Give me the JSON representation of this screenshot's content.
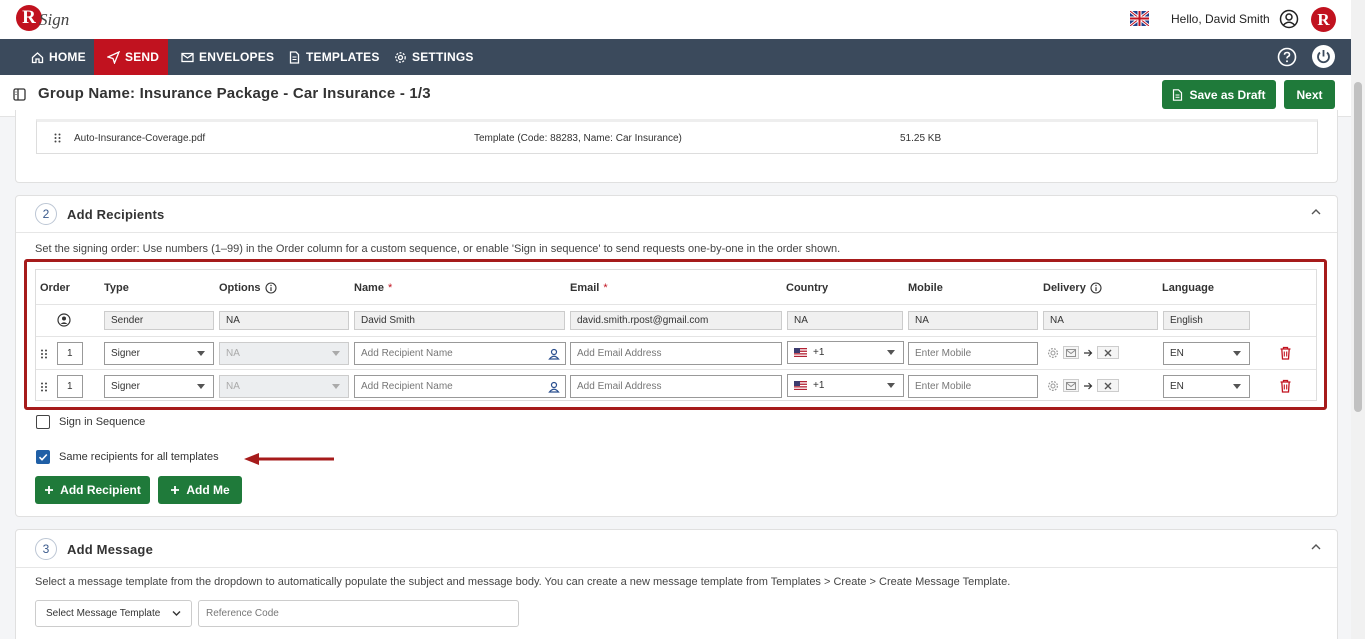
{
  "header": {
    "logo_letter": "R",
    "logo_text": "Sign",
    "greeting": "Hello, David Smith",
    "brand_letter": "R"
  },
  "nav": {
    "items": [
      {
        "label": "HOME",
        "icon": "home-icon"
      },
      {
        "label": "SEND",
        "icon": "send-icon",
        "active": true
      },
      {
        "label": "ENVELOPES",
        "icon": "envelope-icon"
      },
      {
        "label": "TEMPLATES",
        "icon": "template-icon"
      },
      {
        "label": "SETTINGS",
        "icon": "gear-icon"
      }
    ]
  },
  "page": {
    "title": "Group Name: Insurance Package - Car Insurance - 1/3",
    "save_draft_label": "Save as Draft",
    "next_label": "Next"
  },
  "document": {
    "file_name": "Auto-Insurance-Coverage.pdf",
    "template_info": "Template (Code: 88283, Name: Car Insurance)",
    "file_size": "51.25 KB"
  },
  "recipients_section": {
    "number": "2",
    "title": "Add Recipients",
    "hint": "Set the signing order: Use numbers (1–99) in the Order column for a custom sequence, or enable 'Sign in sequence' to send requests one-by-one in the order shown.",
    "columns": {
      "order": "Order",
      "type": "Type",
      "options": "Options",
      "name": "Name",
      "email": "Email",
      "country": "Country",
      "mobile": "Mobile",
      "delivery": "Delivery",
      "language": "Language"
    },
    "required_mark": "*",
    "sender": {
      "type": "Sender",
      "options": "NA",
      "name": "David Smith",
      "email": "david.smith.rpost@gmail.com",
      "country": "NA",
      "mobile": "NA",
      "delivery": "NA",
      "language": "English"
    },
    "rows": [
      {
        "order": "1",
        "type": "Signer",
        "options": "NA",
        "name_placeholder": "Add Recipient Name",
        "email_placeholder": "Add Email Address",
        "country_code": "+1",
        "mobile_placeholder": "Enter Mobile",
        "language": "EN"
      },
      {
        "order": "1",
        "type": "Signer",
        "options": "NA",
        "name_placeholder": "Add Recipient Name",
        "email_placeholder": "Add Email Address",
        "country_code": "+1",
        "mobile_placeholder": "Enter Mobile",
        "language": "EN"
      }
    ],
    "sign_in_sequence_label": "Sign in Sequence",
    "same_recipients_label": "Same recipients for all templates",
    "add_recipient_label": "Add Recipient",
    "add_me_label": "Add Me"
  },
  "message_section": {
    "number": "3",
    "title": "Add Message",
    "hint": "Select a message template from the dropdown to automatically populate the subject and message body. You can create a new message template from Templates > Create > Create Message Template.",
    "select_template_label": "Select Message Template",
    "reference_code_placeholder": "Reference Code"
  },
  "colors": {
    "nav_bg": "#3b4a5c",
    "accent_red": "#c1121f",
    "button_green": "#1f7a3a",
    "checkbox_blue": "#1f5fa6",
    "highlight_red": "#a61b1b"
  }
}
